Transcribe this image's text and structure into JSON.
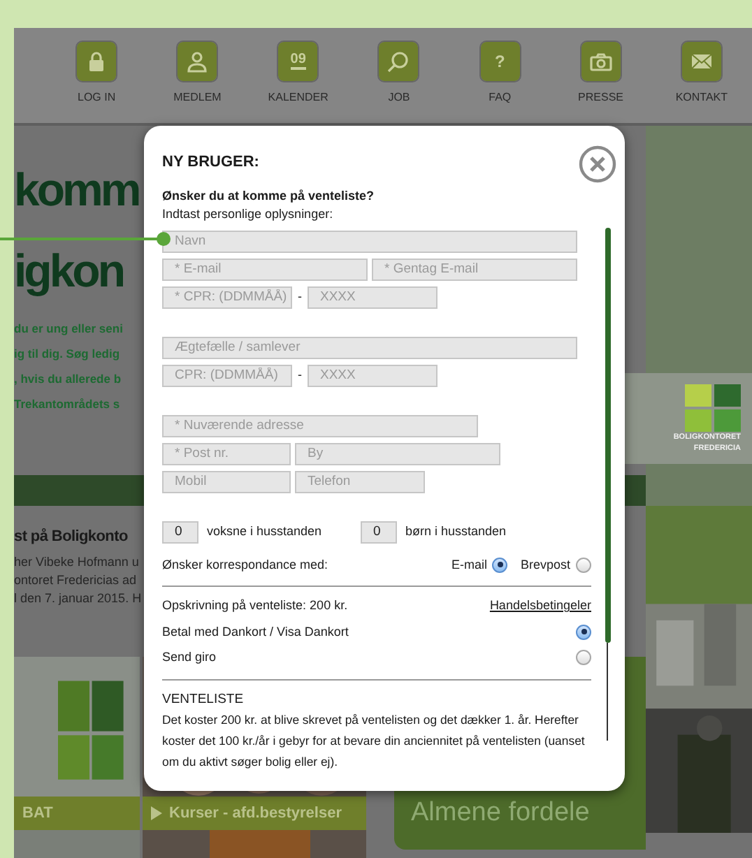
{
  "nav": [
    {
      "label": "LOG IN",
      "kind": "lock"
    },
    {
      "label": "MEDLEM",
      "kind": "person"
    },
    {
      "label": "KALENDER",
      "kind": "calendar",
      "icon_text": "09"
    },
    {
      "label": "JOB",
      "kind": "search"
    },
    {
      "label": "FAQ",
      "kind": "help",
      "icon_text": "?"
    },
    {
      "label": "PRESSE",
      "kind": "camera"
    },
    {
      "label": "KONTAKT",
      "kind": "mail"
    }
  ],
  "hero": {
    "heading": [
      "komm",
      "igkon"
    ],
    "intro": [
      "du er ung eller seni",
      "ig til dig. Søg ledig",
      ", hvis du allerede b",
      "Trekantområdets s"
    ]
  },
  "news": {
    "title": "st på Boligkonto",
    "lines": [
      "her Vibeke Hofmann u",
      "ontoret Fredericias ad",
      "l den 7. januar 2015. H"
    ]
  },
  "logo": {
    "lines": [
      "BOLIGKONTORET",
      "FREDERICIA"
    ]
  },
  "tiles": [
    {
      "kind": "plain",
      "label": "BAT"
    },
    {
      "kind": "arrow",
      "label": "Kurser - afd.bestyrelser"
    }
  ],
  "panel": {
    "title": "Almene fordele"
  },
  "modal": {
    "title": "NY BRUGER:",
    "question": "Ønsker du at komme på venteliste?",
    "instruction": "Indtast personlige oplysninger:",
    "sections": [
      [
        [
          {
            "kind": "field",
            "placeholder": "Navn"
          }
        ],
        [
          {
            "kind": "field",
            "placeholder": "* E-mail"
          },
          {
            "kind": "field",
            "placeholder": "* Gentag E-mail"
          }
        ],
        [
          {
            "kind": "field",
            "placeholder": "* CPR: (DDMMÅÅ)"
          },
          {
            "kind": "dash",
            "text": "-"
          },
          {
            "kind": "field",
            "placeholder": "XXXX"
          }
        ]
      ],
      [
        [
          {
            "kind": "field",
            "placeholder": "Ægtefælle / samlever"
          }
        ],
        [
          {
            "kind": "field",
            "placeholder": "CPR: (DDMMÅÅ)"
          },
          {
            "kind": "dash",
            "text": "-"
          },
          {
            "kind": "field",
            "placeholder": "XXXX"
          }
        ]
      ],
      [
        [
          {
            "kind": "field",
            "placeholder": "* Nuværende adresse"
          }
        ],
        [
          {
            "kind": "field",
            "placeholder": "* Post nr."
          },
          {
            "kind": "field",
            "placeholder": "By"
          }
        ],
        [
          {
            "kind": "field",
            "placeholder": "Mobil"
          },
          {
            "kind": "field",
            "placeholder": "Telefon"
          }
        ]
      ]
    ],
    "household": [
      {
        "value": "0",
        "label": "voksne i husstanden"
      },
      {
        "value": "0",
        "label": "børn i husstanden"
      }
    ],
    "correspondence": {
      "label": "Ønsker korrespondance med:",
      "options": [
        {
          "label": "E-mail",
          "selected": true
        },
        {
          "label": "Brevpost",
          "selected": false
        }
      ]
    },
    "fee": {
      "text": "Opskrivning på venteliste: 200 kr.",
      "link": "Handelsbetingeler"
    },
    "payment": [
      {
        "label": "Betal med Dankort / Visa Dankort",
        "selected": true
      },
      {
        "label": "Send giro",
        "selected": false
      }
    ],
    "info": {
      "title": "VENTELISTE",
      "text": "Det koster 200 kr. at blive skrevet på ventelisten og det dækker 1. år. Herefter koster det 100 kr./år i gebyr for at bevare din anciennitet på ventelisten (uanset om du aktivt søger bolig eller ej)."
    }
  }
}
